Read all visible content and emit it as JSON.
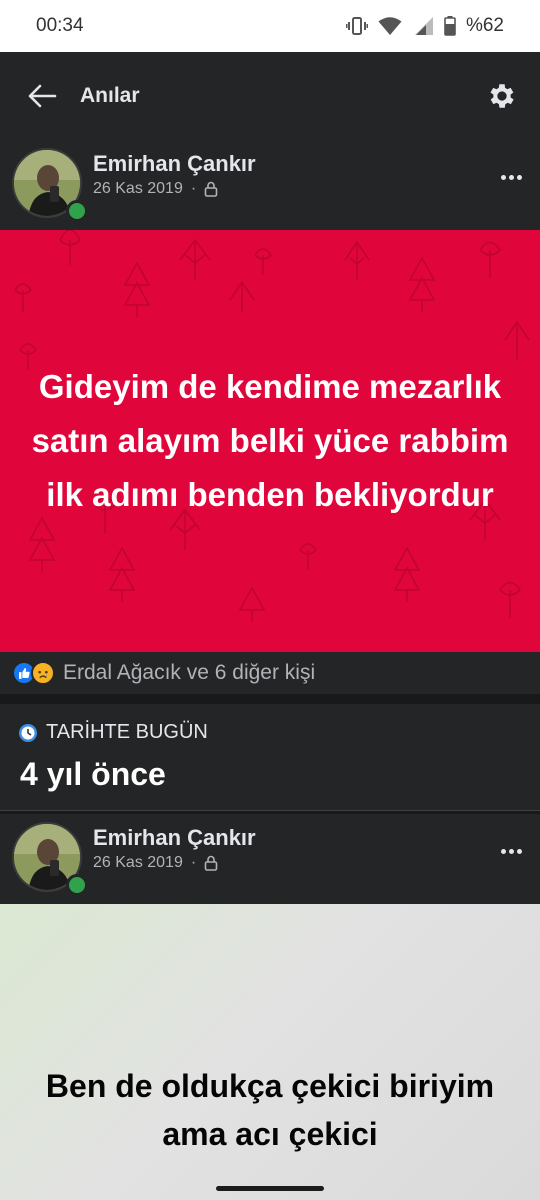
{
  "status_bar": {
    "time": "00:34",
    "battery": "%62",
    "icons": [
      "vibrate-icon",
      "wifi-icon",
      "signal-icon",
      "battery-icon"
    ]
  },
  "app_bar": {
    "title": "Anılar",
    "icons": [
      "back-arrow-icon",
      "gear-icon"
    ]
  },
  "posts": [
    {
      "author": "Emirhan Çankır",
      "date": "26 Kas 2019",
      "separator": "·",
      "privacy_icon": "lock-icon",
      "text": "Gideyim de kendime mezarlık satın alayım belki yüce rabbim ilk adımı benden bekliyordur",
      "background": "#e0063b",
      "reactions": {
        "icons": [
          "like-icon",
          "sad-icon"
        ],
        "text": "Erdal Ağacık ve 6 diğer kişi"
      }
    },
    {
      "author": "Emirhan Çankır",
      "date": "26 Kas 2019",
      "separator": "·",
      "privacy_icon": "lock-icon",
      "text": "Ben de oldukça çekici biriyim ama acı çekici"
    }
  ],
  "on_this_day": {
    "icon": "clock-icon",
    "label": "TARİHTE BUGÜN",
    "years_ago": "4 yıl önce"
  },
  "colors": {
    "background": "#18191a",
    "surface": "#242526",
    "accent_red": "#e0063b",
    "online_green": "#31a24c",
    "like_blue": "#1877f2"
  }
}
